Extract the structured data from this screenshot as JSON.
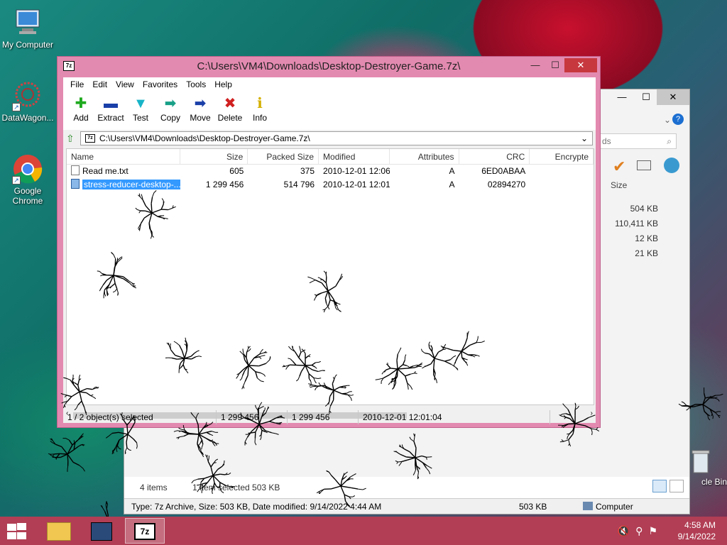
{
  "desktop": {
    "icons": [
      {
        "label": "My Computer"
      },
      {
        "label": "DataWagon..."
      },
      {
        "label": "Google Chrome"
      },
      {
        "label": "cle Bin"
      }
    ]
  },
  "explorer": {
    "search_placeholder": "ds",
    "size_header": "Size",
    "sizes": [
      "504 KB",
      "110,411 KB",
      "12 KB",
      "21 KB"
    ],
    "items_count": "4 items",
    "selection": "1 item selected  503 KB",
    "status_type": "Type: 7z Archive, Size: 503 KB, Date modified: 9/14/2022 4:44 AM",
    "status_size": "503 KB",
    "status_location": "Computer"
  },
  "sevenzip": {
    "title": "C:\\Users\\VM4\\Downloads\\Desktop-Destroyer-Game.7z\\",
    "logo": "7z",
    "menu": [
      "File",
      "Edit",
      "View",
      "Favorites",
      "Tools",
      "Help"
    ],
    "toolbar": [
      {
        "label": "Add",
        "icon": "plus-icon",
        "color": "#1faa1f"
      },
      {
        "label": "Extract",
        "icon": "minus-icon",
        "color": "#1a3fa8"
      },
      {
        "label": "Test",
        "icon": "check-icon",
        "color": "#18b4c8"
      },
      {
        "label": "Copy",
        "icon": "double-arrow-icon",
        "color": "#18a088"
      },
      {
        "label": "Move",
        "icon": "arrow-right-icon",
        "color": "#1a3fa8"
      },
      {
        "label": "Delete",
        "icon": "x-icon",
        "color": "#d02020"
      },
      {
        "label": "Info",
        "icon": "info-icon",
        "color": "#e0c000"
      }
    ],
    "address": "C:\\Users\\VM4\\Downloads\\Desktop-Destroyer-Game.7z\\",
    "columns": {
      "name": "Name",
      "size": "Size",
      "packed": "Packed Size",
      "modified": "Modified",
      "attributes": "Attributes",
      "crc": "CRC",
      "encrypted": "Encrypte"
    },
    "rows": [
      {
        "name": "Read me.txt",
        "size": "605",
        "packed": "375",
        "modified": "2010-12-01 12:06",
        "attributes": "A",
        "crc": "6ED0ABAA",
        "encrypted": ""
      },
      {
        "name": "stress-reducer-desktop-...",
        "size": "1 299 456",
        "packed": "514 796",
        "modified": "2010-12-01 12:01",
        "attributes": "A",
        "crc": "02894270",
        "encrypted": ""
      }
    ],
    "status": {
      "selected": "1 / 2 object(s) selected",
      "size": "1 299 456",
      "packed": "1 299 456",
      "modified": "2010-12-01 12:01:04"
    }
  },
  "taskbar": {
    "time": "4:58 AM",
    "date": "9/14/2022"
  },
  "colors": {
    "taskbar": "#b13e54",
    "sevenzip_frame": "#e38ab0",
    "selection": "#3399ff"
  }
}
